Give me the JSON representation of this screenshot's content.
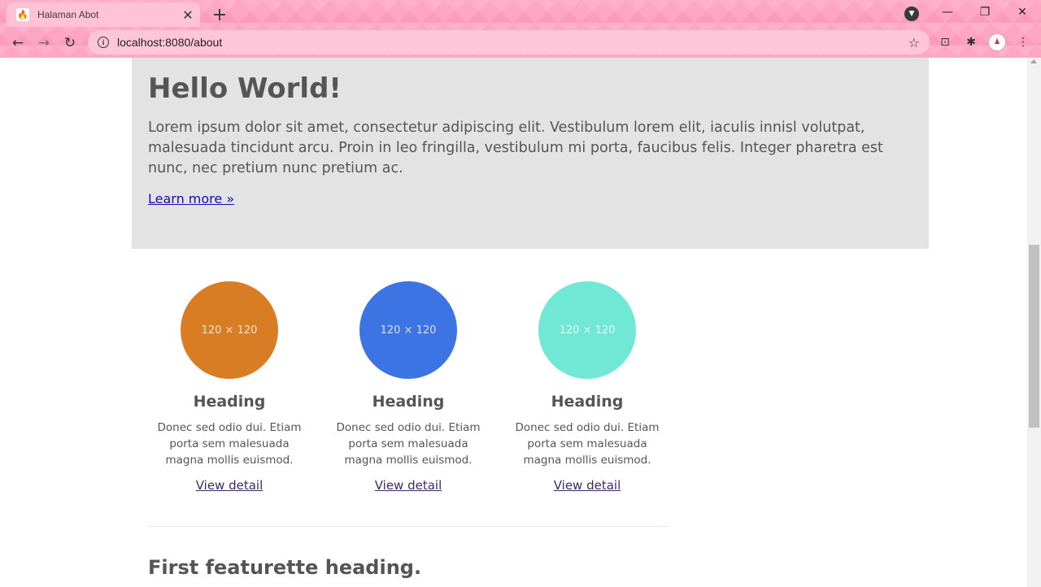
{
  "browser": {
    "tab_title": "Halaman Abot",
    "url": "localhost:8080/about",
    "colors": {
      "frame": "#ffa6c4",
      "omnibox": "#ffc5d9"
    }
  },
  "icons": {
    "tab_favicon": "flame-icon",
    "close": "close-icon",
    "new_tab": "plus-icon",
    "tab_search": "chevron-down-icon",
    "back": "back-arrow-icon",
    "forward": "forward-arrow-icon",
    "reload": "reload-icon",
    "site_info": "info-icon",
    "bookmark": "star-icon",
    "extensions": "puzzle-icon",
    "menu": "kebab-menu-icon"
  },
  "jumbotron": {
    "title": "Hello World!",
    "text": "Lorem ipsum dolor sit amet, consectetur adipiscing elit. Vestibulum lorem elit, iaculis innisl volutpat, malesuada tincidunt arcu. Proin in leo fringilla, vestibulum mi porta, faucibus felis. Integer pharetra est nunc, nec pretium nunc pretium ac.",
    "link": "Learn more »",
    "background": "#e3e3e3"
  },
  "features": [
    {
      "placeholder": "120 × 120",
      "color": "#d97d25",
      "heading": "Heading",
      "text": "Donec sed odio dui. Etiam porta sem malesuada magna mollis euismod.",
      "link": "View detail"
    },
    {
      "placeholder": "120 × 120",
      "color": "#3d74e3",
      "heading": "Heading",
      "text": "Donec sed odio dui. Etiam porta sem malesuada magna mollis euismod.",
      "link": "View detail"
    },
    {
      "placeholder": "120 × 120",
      "color": "#71e8d6",
      "heading": "Heading",
      "text": "Donec sed odio dui. Etiam porta sem malesuada magna mollis euismod.",
      "link": "View detail"
    }
  ],
  "featurette": {
    "heading": "First featurette heading."
  }
}
